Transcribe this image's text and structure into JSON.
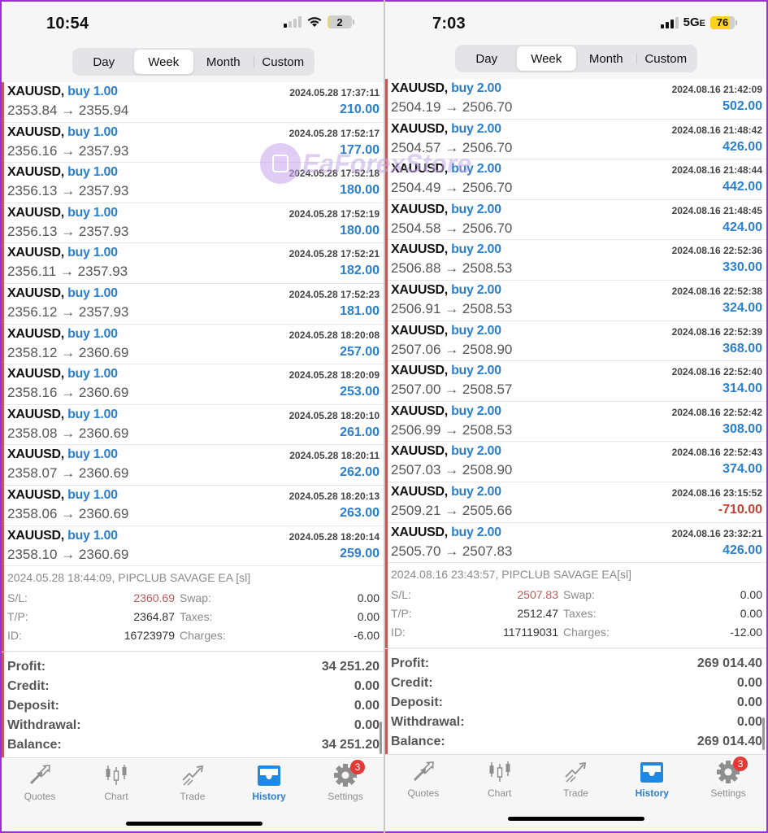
{
  "screens": [
    {
      "status": {
        "time": "10:54",
        "network": "",
        "battery": "2"
      },
      "periods": [
        "Day",
        "Week",
        "Month",
        "Custom"
      ],
      "active_period": "Week",
      "deals": [
        {
          "symbol": "XAUUSD,",
          "type": "buy 1.00",
          "open": "2353.84",
          "arrow": "→",
          "close": "2355.94",
          "datetime": "2024.05.28 17:37:11",
          "profit": "210.00"
        },
        {
          "symbol": "XAUUSD,",
          "type": "buy 1.00",
          "open": "2356.16",
          "arrow": "→",
          "close": "2357.93",
          "datetime": "2024.05.28 17:52:17",
          "profit": "177.00"
        },
        {
          "symbol": "XAUUSD,",
          "type": "buy 1.00",
          "open": "2356.13",
          "arrow": "→",
          "close": "2357.93",
          "datetime": "2024.05.28 17:52:18",
          "profit": "180.00"
        },
        {
          "symbol": "XAUUSD,",
          "type": "buy 1.00",
          "open": "2356.13",
          "arrow": "→",
          "close": "2357.93",
          "datetime": "2024.05.28 17:52:19",
          "profit": "180.00"
        },
        {
          "symbol": "XAUUSD,",
          "type": "buy 1.00",
          "open": "2356.11",
          "arrow": "→",
          "close": "2357.93",
          "datetime": "2024.05.28 17:52:21",
          "profit": "182.00"
        },
        {
          "symbol": "XAUUSD,",
          "type": "buy 1.00",
          "open": "2356.12",
          "arrow": "→",
          "close": "2357.93",
          "datetime": "2024.05.28 17:52:23",
          "profit": "181.00"
        },
        {
          "symbol": "XAUUSD,",
          "type": "buy 1.00",
          "open": "2358.12",
          "arrow": "→",
          "close": "2360.69",
          "datetime": "2024.05.28 18:20:08",
          "profit": "257.00"
        },
        {
          "symbol": "XAUUSD,",
          "type": "buy 1.00",
          "open": "2358.16",
          "arrow": "→",
          "close": "2360.69",
          "datetime": "2024.05.28 18:20:09",
          "profit": "253.00"
        },
        {
          "symbol": "XAUUSD,",
          "type": "buy 1.00",
          "open": "2358.08",
          "arrow": "→",
          "close": "2360.69",
          "datetime": "2024.05.28 18:20:10",
          "profit": "261.00"
        },
        {
          "symbol": "XAUUSD,",
          "type": "buy 1.00",
          "open": "2358.07",
          "arrow": "→",
          "close": "2360.69",
          "datetime": "2024.05.28 18:20:11",
          "profit": "262.00"
        },
        {
          "symbol": "XAUUSD,",
          "type": "buy 1.00",
          "open": "2358.06",
          "arrow": "→",
          "close": "2360.69",
          "datetime": "2024.05.28 18:20:13",
          "profit": "263.00"
        },
        {
          "symbol": "XAUUSD,",
          "type": "buy 1.00",
          "open": "2358.10",
          "arrow": "→",
          "close": "2360.69",
          "datetime": "2024.05.28 18:20:14",
          "profit": "259.00"
        }
      ],
      "details": {
        "comment": "2024.05.28 18:44:09, PIPCLUB SAVAGE EA [sl]",
        "rows": [
          {
            "k1": "S/L:",
            "v1": "2360.69",
            "k2": "Swap:",
            "v2": "0.00"
          },
          {
            "k1": "T/P:",
            "v1": "2364.87",
            "k2": "Taxes:",
            "v2": "0.00"
          },
          {
            "k1": "ID:",
            "v1": "16723979",
            "k2": "Charges:",
            "v2": "-6.00"
          }
        ]
      },
      "summary": [
        {
          "label": "Profit:",
          "value": "34 251.20"
        },
        {
          "label": "Credit:",
          "value": "0.00"
        },
        {
          "label": "Deposit:",
          "value": "0.00"
        },
        {
          "label": "Withdrawal:",
          "value": "0.00"
        },
        {
          "label": "Balance:",
          "value": "34 251.20"
        }
      ]
    },
    {
      "status": {
        "time": "7:03",
        "network": "5G",
        "network_suffix": "E",
        "battery": "76"
      },
      "periods": [
        "Day",
        "Week",
        "Month",
        "Custom"
      ],
      "active_period": "Week",
      "deals": [
        {
          "symbol": "XAUUSD,",
          "type": "buy 2.00",
          "open": "2504.19",
          "arrow": "→",
          "close": "2506.70",
          "datetime": "2024.08.16 21:42:09",
          "profit": "502.00"
        },
        {
          "symbol": "XAUUSD,",
          "type": "buy 2.00",
          "open": "2504.57",
          "arrow": "→",
          "close": "2506.70",
          "datetime": "2024.08.16 21:48:42",
          "profit": "426.00"
        },
        {
          "symbol": "XAUUSD,",
          "type": "buy 2.00",
          "open": "2504.49",
          "arrow": "→",
          "close": "2506.70",
          "datetime": "2024.08.16 21:48:44",
          "profit": "442.00"
        },
        {
          "symbol": "XAUUSD,",
          "type": "buy 2.00",
          "open": "2504.58",
          "arrow": "→",
          "close": "2506.70",
          "datetime": "2024.08.16 21:48:45",
          "profit": "424.00"
        },
        {
          "symbol": "XAUUSD,",
          "type": "buy 2.00",
          "open": "2506.88",
          "arrow": "→",
          "close": "2508.53",
          "datetime": "2024.08.16 22:52:36",
          "profit": "330.00"
        },
        {
          "symbol": "XAUUSD,",
          "type": "buy 2.00",
          "open": "2506.91",
          "arrow": "→",
          "close": "2508.53",
          "datetime": "2024.08.16 22:52:38",
          "profit": "324.00"
        },
        {
          "symbol": "XAUUSD,",
          "type": "buy 2.00",
          "open": "2507.06",
          "arrow": "→",
          "close": "2508.90",
          "datetime": "2024.08.16 22:52:39",
          "profit": "368.00"
        },
        {
          "symbol": "XAUUSD,",
          "type": "buy 2.00",
          "open": "2507.00",
          "arrow": "→",
          "close": "2508.57",
          "datetime": "2024.08.16 22:52:40",
          "profit": "314.00"
        },
        {
          "symbol": "XAUUSD,",
          "type": "buy 2.00",
          "open": "2506.99",
          "arrow": "→",
          "close": "2508.53",
          "datetime": "2024.08.16 22:52:42",
          "profit": "308.00"
        },
        {
          "symbol": "XAUUSD,",
          "type": "buy 2.00",
          "open": "2507.03",
          "arrow": "→",
          "close": "2508.90",
          "datetime": "2024.08.16 22:52:43",
          "profit": "374.00"
        },
        {
          "symbol": "XAUUSD,",
          "type": "buy 2.00",
          "open": "2509.21",
          "arrow": "→",
          "close": "2505.66",
          "datetime": "2024.08.16 23:15:52",
          "profit": "-710.00",
          "negative": true
        },
        {
          "symbol": "XAUUSD,",
          "type": "buy 2.00",
          "open": "2505.70",
          "arrow": "→",
          "close": "2507.83",
          "datetime": "2024.08.16 23:32:21",
          "profit": "426.00"
        }
      ],
      "details": {
        "comment": "2024.08.16 23:43:57, PIPCLUB SAVAGE EA[sl]",
        "rows": [
          {
            "k1": "S/L:",
            "v1": "2507.83",
            "k2": "Swap:",
            "v2": "0.00"
          },
          {
            "k1": "T/P:",
            "v1": "2512.47",
            "k2": "Taxes:",
            "v2": "0.00"
          },
          {
            "k1": "ID:",
            "v1": "117119031",
            "k2": "Charges:",
            "v2": "-12.00"
          }
        ]
      },
      "summary": [
        {
          "label": "Profit:",
          "value": "269 014.40"
        },
        {
          "label": "Credit:",
          "value": "0.00"
        },
        {
          "label": "Deposit:",
          "value": "0.00"
        },
        {
          "label": "Withdrawal:",
          "value": "0.00"
        },
        {
          "label": "Balance:",
          "value": "269 014.40"
        }
      ]
    }
  ],
  "tabbar": {
    "items": [
      {
        "label": "Quotes",
        "icon": "quotes-icon"
      },
      {
        "label": "Chart",
        "icon": "chart-icon"
      },
      {
        "label": "Trade",
        "icon": "trade-icon"
      },
      {
        "label": "History",
        "icon": "history-icon",
        "active": true
      },
      {
        "label": "Settings",
        "icon": "settings-icon",
        "badge": "3"
      }
    ]
  },
  "watermark": "EaForexStore",
  "colors": {
    "accent": "#2a7fd0",
    "negative": "#d03c32",
    "sl_value": "#c05a5a",
    "badge": "#e53935"
  }
}
